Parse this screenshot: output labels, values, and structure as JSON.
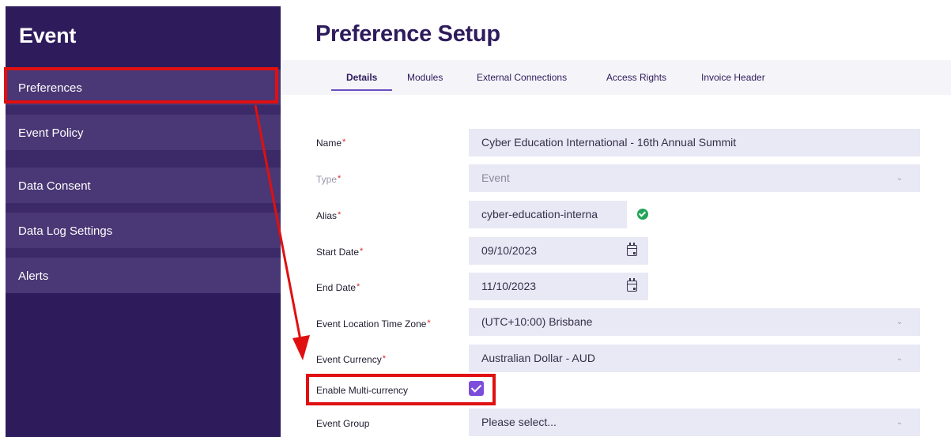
{
  "sidebar": {
    "title": "Event",
    "items": [
      {
        "label": "Preferences"
      },
      {
        "label": "Event Policy"
      },
      {
        "label": "Data Consent"
      },
      {
        "label": "Data Log Settings"
      },
      {
        "label": "Alerts"
      }
    ]
  },
  "main": {
    "title": "Preference Setup",
    "tabs": [
      {
        "label": "Details",
        "active": true
      },
      {
        "label": "Modules"
      },
      {
        "label": "External Connections"
      },
      {
        "label": "Access Rights"
      },
      {
        "label": "Invoice Header"
      }
    ]
  },
  "form": {
    "name": {
      "label": "Name",
      "value": "Cyber Education International - 16th Annual Summit"
    },
    "type": {
      "label": "Type",
      "value": "Event"
    },
    "alias": {
      "label": "Alias",
      "value": "cyber-education-interna"
    },
    "start_date": {
      "label": "Start Date",
      "value": "09/10/2023"
    },
    "end_date": {
      "label": "End Date",
      "value": "11/10/2023"
    },
    "timezone": {
      "label": "Event Location Time Zone",
      "value": "(UTC+10:00) Brisbane"
    },
    "currency": {
      "label": "Event Currency",
      "value": "Australian Dollar - AUD"
    },
    "multi_currency": {
      "label": "Enable Multi-currency",
      "checked": true
    },
    "event_group": {
      "label": "Event Group",
      "placeholder": "Please select..."
    }
  },
  "icons": {
    "chevron": "chevron-down-icon",
    "calendar": "calendar-icon",
    "alias_status": "check-circle-icon"
  },
  "colors": {
    "sidebar_bg": "#2e1b5c",
    "sidebar_item_bg": "#4a3775",
    "field_bg": "#e9e8f5",
    "accent": "#7c4ddb",
    "annotation_red": "#e01010"
  }
}
